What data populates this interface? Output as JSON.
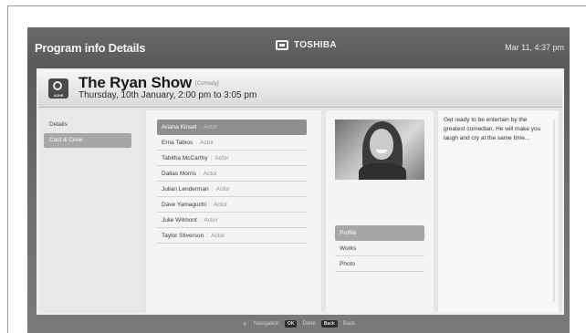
{
  "app": {
    "title": "Program info Details",
    "brand": "TOSHIBA",
    "clock": "Mar 11, 4:37 pm"
  },
  "program": {
    "channel_logo_text": "ASHE",
    "title": "The Ryan Show",
    "genre": "[Comedy]",
    "datetime": "Thursday, 10th January,  2:00 pm to 3:05 pm"
  },
  "sidebar": {
    "items": [
      {
        "label": "Details"
      },
      {
        "label": "Cast & Crew"
      }
    ],
    "selected_index": 1
  },
  "cast": {
    "separator": ":",
    "members": [
      {
        "name": "Ariana Kinsel",
        "role": "Actor"
      },
      {
        "name": "Erna Tabios",
        "role": "Actor"
      },
      {
        "name": "Tabitha McCarthy",
        "role": "Actor"
      },
      {
        "name": "Dallas Morris",
        "role": "Actor"
      },
      {
        "name": "Julian Lenderman",
        "role": "Actor"
      },
      {
        "name": "Dave Yamaguchi",
        "role": "Actor"
      },
      {
        "name": "Julie Wilmont",
        "role": "Actor"
      },
      {
        "name": "Taylor Stiverson",
        "role": "Actor"
      }
    ],
    "selected_index": 0
  },
  "profile": {
    "menu": [
      {
        "label": "Profile"
      },
      {
        "label": "Works"
      },
      {
        "label": "Photo"
      }
    ],
    "selected_index": 0
  },
  "description": {
    "text": "Get ready to be entertain by the greatest comedian. He will make you laugh and cry at the same time..."
  },
  "footer": {
    "navigation_label": "Navigation",
    "ok_key": "OK",
    "ok_label": "Done",
    "back_key": "Back",
    "back_label": "Back"
  }
}
